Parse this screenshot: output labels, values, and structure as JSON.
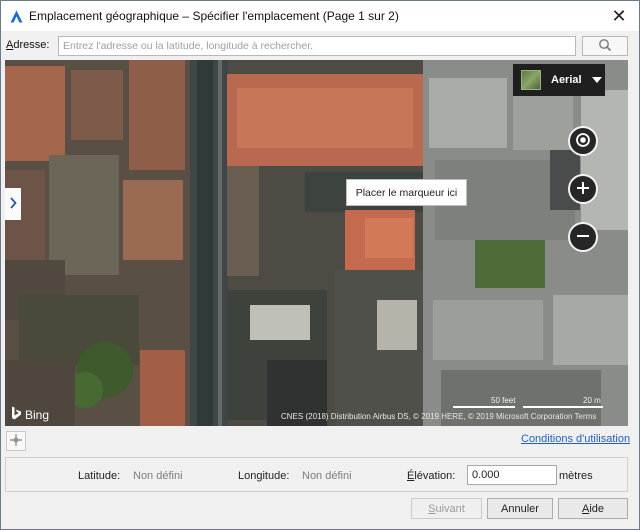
{
  "window": {
    "title": "Emplacement géographique – Spécifier l'emplacement (Page 1 sur 2)",
    "close_glyph": "✕"
  },
  "address": {
    "label_mnemonic": "A",
    "label_rest": "dresse:",
    "placeholder": "Entrez l'adresse ou la latitude, longitude à rechercher.",
    "value": ""
  },
  "map": {
    "layer_label": "Aerial",
    "tooltip": "Placer le marqueur ici",
    "provider": "Bing",
    "scale_feet": "50 feet",
    "scale_meters": "20 m",
    "attribution": "CNES (2018) Distribution Airbus DS, © 2019 HERE, © 2019 Microsoft Corporation Terms",
    "icons": [
      "locate-icon",
      "zoom-in-icon",
      "zoom-out-icon",
      "expand-panel-icon",
      "layer-thumbnail-icon",
      "bing-logo-icon"
    ]
  },
  "links": {
    "terms": "Conditions d'utilisation"
  },
  "coords": {
    "latitude_label": "Latitude:",
    "latitude_value": "Non défini",
    "longitude_label": "Longitude:",
    "longitude_value": "Non défini",
    "elevation_mnemonic": "É",
    "elevation_rest": "lévation:",
    "elevation_value": "0.000",
    "elevation_unit": "mètres"
  },
  "buttons": {
    "next_mnemonic": "S",
    "next_rest": "uivant",
    "cancel": "Annuler",
    "help_mnemonic": "A",
    "help_rest": "ide"
  },
  "colors": {
    "accent": "#1f5fbf",
    "map_controls": "#262626"
  }
}
